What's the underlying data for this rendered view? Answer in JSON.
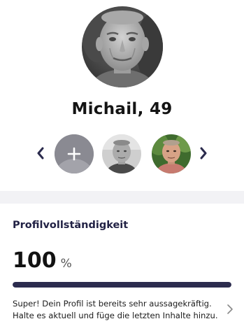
{
  "profile": {
    "name": "Michail",
    "age_suffix": ", 49"
  },
  "gallery": {
    "add_photo_icon": "plus-icon",
    "prev_icon": "chevron-left-icon",
    "next_icon": "chevron-right-icon"
  },
  "completeness": {
    "title": "Profilvollständigkeit",
    "value": "100",
    "unit": "%",
    "progress_fraction": 1.0,
    "hint_line1": "Super! Dein Profil ist bereits sehr aussagekräftig.",
    "hint_line2": "Halte es aktuell und füge die letzten Inhalte hinzu.",
    "hint_icon": "chevron-right-icon"
  },
  "colors": {
    "accent": "#2c2c4e",
    "arrow": "#2b2b4d",
    "track": "#e5e5ec",
    "separator": "#f2f2f5"
  }
}
